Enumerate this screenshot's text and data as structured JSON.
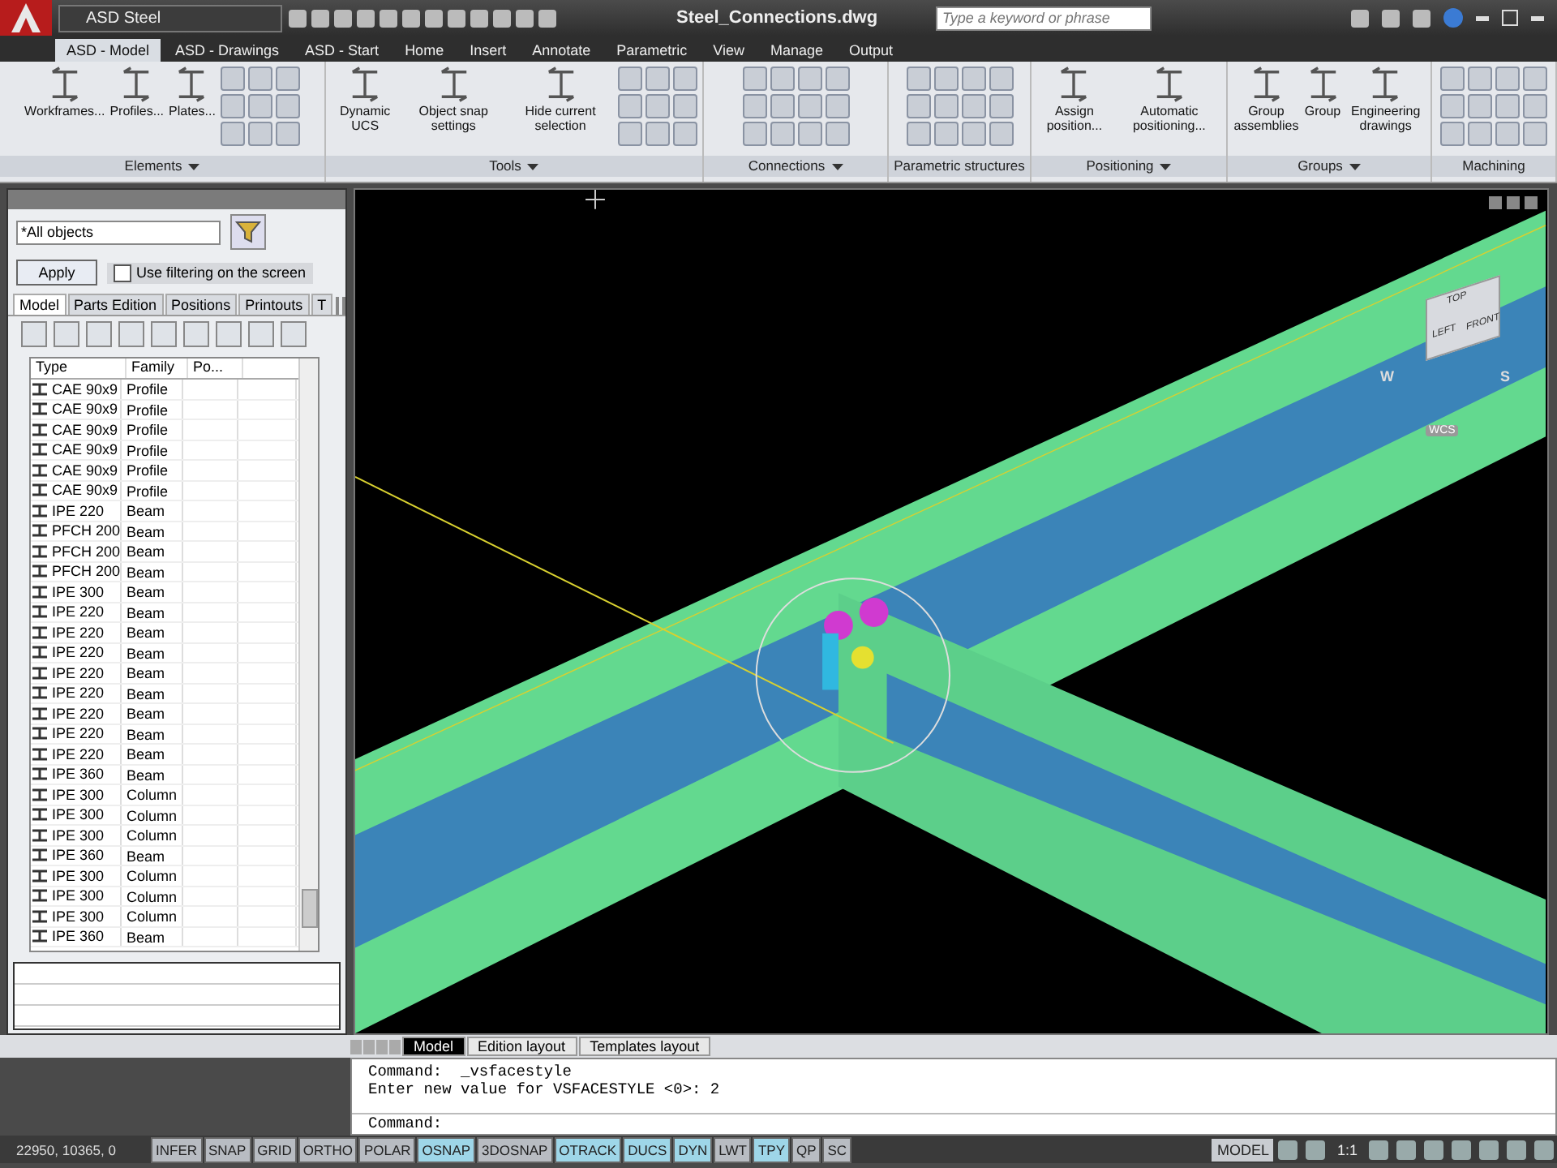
{
  "window": {
    "title": "Steel_Connections.dwg",
    "workspace": "ASD Steel",
    "search": {
      "placeholder": "Type a keyword or phrase"
    }
  },
  "ribbon_tabs": [
    {
      "label": "ASD - Model",
      "selected": true
    },
    {
      "label": "ASD - Drawings",
      "selected": false
    },
    {
      "label": "ASD - Start",
      "selected": false
    },
    {
      "label": "Home",
      "selected": false
    },
    {
      "label": "Insert",
      "selected": false
    },
    {
      "label": "Annotate",
      "selected": false
    },
    {
      "label": "Parametric",
      "selected": false
    },
    {
      "label": "View",
      "selected": false
    },
    {
      "label": "Manage",
      "selected": false
    },
    {
      "label": "Output",
      "selected": false
    }
  ],
  "ribbon_panels": [
    {
      "title": "Elements",
      "menu": true,
      "kind": "mixed",
      "buttons": [
        "Workframes...",
        "Profiles...",
        "Plates..."
      ]
    },
    {
      "title": "Tools",
      "menu": true,
      "kind": "mixed",
      "buttons": [
        "Dynamic UCS",
        "Object snap settings",
        "Hide current selection"
      ]
    },
    {
      "title": "Connections",
      "menu": true,
      "kind": "grid"
    },
    {
      "title": "Parametric structures",
      "menu": false,
      "kind": "grid"
    },
    {
      "title": "Positioning",
      "menu": true,
      "kind": "buttons",
      "buttons": [
        "Assign position...",
        "Automatic positioning..."
      ]
    },
    {
      "title": "Groups",
      "menu": true,
      "kind": "buttons",
      "buttons": [
        "Group assemblies",
        "Group",
        "Engineering drawings"
      ]
    },
    {
      "title": "Machining",
      "menu": false,
      "kind": "grid"
    }
  ],
  "filter": {
    "value": "*All objects",
    "apply": "Apply",
    "checkbox": {
      "label": "Use filtering on the screen",
      "checked": false
    }
  },
  "panel_tabs": [
    {
      "label": "Model",
      "selected": true
    },
    {
      "label": "Parts Edition",
      "selected": false
    },
    {
      "label": "Positions",
      "selected": false
    },
    {
      "label": "Printouts",
      "selected": false
    },
    {
      "label": "T",
      "selected": false
    }
  ],
  "table": {
    "columns": [
      "Type",
      "Family",
      "Po..."
    ],
    "rows": [
      {
        "type": "CAE 90x9",
        "family": "Profile"
      },
      {
        "type": "CAE 90x9",
        "family": "Profile"
      },
      {
        "type": "CAE 90x9",
        "family": "Profile"
      },
      {
        "type": "CAE 90x9",
        "family": "Profile"
      },
      {
        "type": "CAE 90x9",
        "family": "Profile"
      },
      {
        "type": "CAE 90x9",
        "family": "Profile"
      },
      {
        "type": "IPE 220",
        "family": "Beam"
      },
      {
        "type": "PFCH 200",
        "family": "Beam"
      },
      {
        "type": "PFCH 200",
        "family": "Beam"
      },
      {
        "type": "PFCH 200",
        "family": "Beam"
      },
      {
        "type": "IPE 300",
        "family": "Beam"
      },
      {
        "type": "IPE 220",
        "family": "Beam"
      },
      {
        "type": "IPE 220",
        "family": "Beam"
      },
      {
        "type": "IPE 220",
        "family": "Beam"
      },
      {
        "type": "IPE 220",
        "family": "Beam"
      },
      {
        "type": "IPE 220",
        "family": "Beam"
      },
      {
        "type": "IPE 220",
        "family": "Beam"
      },
      {
        "type": "IPE 220",
        "family": "Beam"
      },
      {
        "type": "IPE 220",
        "family": "Beam"
      },
      {
        "type": "IPE 360",
        "family": "Beam"
      },
      {
        "type": "IPE 300",
        "family": "Column"
      },
      {
        "type": "IPE 300",
        "family": "Column"
      },
      {
        "type": "IPE 300",
        "family": "Column"
      },
      {
        "type": "IPE 360",
        "family": "Beam"
      },
      {
        "type": "IPE 300",
        "family": "Column"
      },
      {
        "type": "IPE 300",
        "family": "Column"
      },
      {
        "type": "IPE 300",
        "family": "Column"
      },
      {
        "type": "IPE 360",
        "family": "Beam"
      }
    ]
  },
  "viewcube": {
    "top": "TOP",
    "left": "LEFT",
    "front": "FRONT",
    "west": "W",
    "south": "S",
    "ucs": "WCS"
  },
  "layout_tabs": [
    {
      "label": "Model",
      "selected": true
    },
    {
      "label": "Edition layout",
      "selected": false
    },
    {
      "label": "Templates layout",
      "selected": false
    }
  ],
  "command_history": [
    "Command:  _vsfacestyle",
    "Enter new value for VSFACESTYLE <0>: 2"
  ],
  "command_prompt": "Command:",
  "status_bar": {
    "coordinates": "22950, 10365, 0",
    "toggles": [
      {
        "label": "INFER",
        "on": false
      },
      {
        "label": "SNAP",
        "on": false
      },
      {
        "label": "GRID",
        "on": false
      },
      {
        "label": "ORTHO",
        "on": false
      },
      {
        "label": "POLAR",
        "on": false
      },
      {
        "label": "OSNAP",
        "on": true
      },
      {
        "label": "3DOSNAP",
        "on": false
      },
      {
        "label": "OTRACK",
        "on": true
      },
      {
        "label": "DUCS",
        "on": true
      },
      {
        "label": "DYN",
        "on": true
      },
      {
        "label": "LWT",
        "on": false
      },
      {
        "label": "TPY",
        "on": true
      },
      {
        "label": "QP",
        "on": false
      },
      {
        "label": "SC",
        "on": false
      }
    ],
    "space": "MODEL",
    "scale": "1:1"
  }
}
